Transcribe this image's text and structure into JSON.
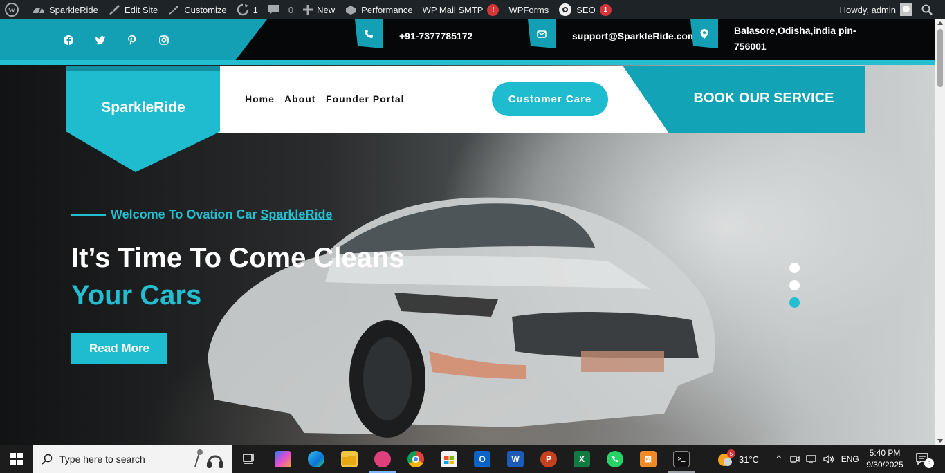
{
  "admin_bar": {
    "site_name": "SparkleRide",
    "edit_site": "Edit Site",
    "customize": "Customize",
    "updates_count": "1",
    "comments_count": "0",
    "new_label": "New",
    "performance": "Performance",
    "wp_mail_smtp": "WP Mail SMTP",
    "wp_mail_smtp_badge": "!",
    "wpforms": "WPForms",
    "seo": "SEO",
    "seo_badge": "1",
    "howdy": "Howdy, admin"
  },
  "topbar": {
    "phone": "+91-7377785172",
    "email": "support@SparkleRide.com",
    "address_line1": "Balasore,Odisha,india pin-",
    "address_line2": "756001"
  },
  "nav": {
    "logo": "SparkleRide",
    "links": [
      "Home",
      "About",
      "Founder Portal"
    ],
    "customer_care": "Customer Care",
    "book_service": "BOOK OUR SERVICE"
  },
  "hero": {
    "welcome_prefix": "Welcome To Ovation Car",
    "welcome_link": "SparkleRide",
    "headline_line1": "It’s Time To Come Cleans",
    "headline_line2": "Your Cars",
    "read_more": "Read More",
    "slides_total": 3,
    "active_slide": 3
  },
  "taskbar": {
    "search_placeholder": "Type here to search",
    "temperature": "31°C",
    "language": "ENG",
    "time": "5:40 PM",
    "date": "9/30/2025",
    "weather_badge": "5",
    "notifications_count": "3"
  },
  "colors": {
    "accent": "#1fbccf",
    "accent_dark": "#13a3b6",
    "admin_bar": "#1d2327"
  }
}
